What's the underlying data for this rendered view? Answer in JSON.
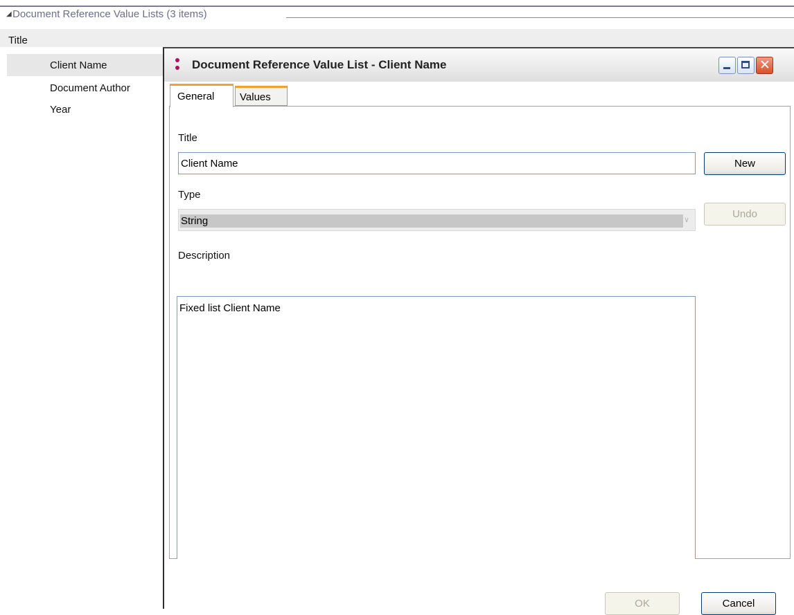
{
  "group": {
    "label": "Document Reference Value Lists (3 items)"
  },
  "list": {
    "column_header": "Title",
    "items": [
      "Client Name",
      "Document Author",
      "Year"
    ]
  },
  "dialog": {
    "title": "Document Reference Value List - Client Name",
    "tabs": [
      {
        "label": "General",
        "selected": true
      },
      {
        "label": "Values",
        "selected": false
      }
    ],
    "title_field": {
      "label": "Title",
      "value": "Client Name"
    },
    "type_field": {
      "label": "Type",
      "value": "String"
    },
    "description_field": {
      "label": "Description",
      "value": "Fixed list Client Name"
    },
    "buttons": {
      "new": "New",
      "undo": "Undo",
      "ok": "OK",
      "cancel": "Cancel"
    },
    "icons": {
      "app": "app-icon",
      "minimize": "minimize-icon",
      "maximize": "maximize-icon",
      "close": "close-icon"
    }
  },
  "colors": {
    "tab_accent": "#f0a130",
    "close_button": "#d94f2b",
    "app_icon": "#b0115b"
  }
}
